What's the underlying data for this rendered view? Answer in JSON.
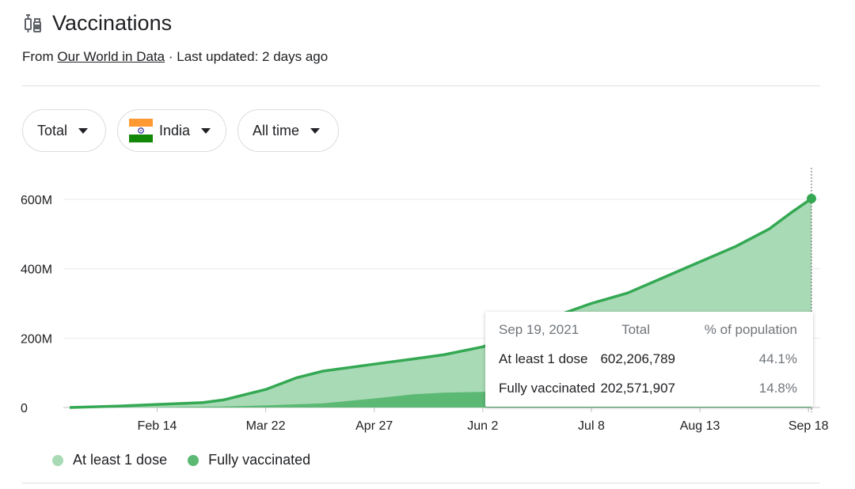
{
  "header": {
    "title": "Vaccinations",
    "source_prefix": "From",
    "source_link": "Our World in Data",
    "updated": "· Last updated: 2 days ago"
  },
  "filters": {
    "metric": "Total",
    "country": "India",
    "range": "All time"
  },
  "tooltip": {
    "date": "Sep 19, 2021",
    "col_total": "Total",
    "col_pct": "% of population",
    "rows": [
      {
        "label": "At least 1 dose",
        "total": "602,206,789",
        "pct": "44.1%"
      },
      {
        "label": "Fully vaccinated",
        "total": "202,571,907",
        "pct": "14.8%"
      }
    ]
  },
  "legend": {
    "first": "At least 1 dose",
    "second": "Fully vaccinated"
  },
  "colors": {
    "first_fill": "#a8dab5",
    "first_line": "#34a853",
    "second_fill": "#5bb974",
    "grid": "#e8eaed",
    "text_muted": "#70757a"
  },
  "icons": {
    "title": "syringe-icon",
    "flag": "india-flag-icon",
    "caret": "caret-down-icon"
  },
  "chart_data": {
    "type": "area",
    "title": "",
    "xlabel": "",
    "ylabel": "",
    "ylim": [
      0,
      600000000
    ],
    "yticks": [
      0,
      200000000,
      400000000,
      600000000
    ],
    "ytick_labels": [
      "0",
      "200M",
      "400M",
      "600M"
    ],
    "xtick_labels": [
      "Feb 14",
      "Mar 22",
      "Apr 27",
      "Jun 2",
      "Jul 8",
      "Aug 13",
      "Sep 18"
    ],
    "xtick_dates": [
      "2021-02-14",
      "2021-03-22",
      "2021-04-27",
      "2021-06-02",
      "2021-07-08",
      "2021-08-13",
      "2021-09-18"
    ],
    "xlim": [
      "2021-01-16",
      "2021-09-19"
    ],
    "series": [
      {
        "name": "At least 1 dose",
        "x": [
          "2021-01-16",
          "2021-02-01",
          "2021-02-14",
          "2021-03-01",
          "2021-03-08",
          "2021-03-22",
          "2021-04-01",
          "2021-04-10",
          "2021-04-27",
          "2021-05-10",
          "2021-05-20",
          "2021-06-02",
          "2021-06-15",
          "2021-06-25",
          "2021-07-08",
          "2021-07-20",
          "2021-08-01",
          "2021-08-13",
          "2021-08-25",
          "2021-09-05",
          "2021-09-12",
          "2021-09-19"
        ],
        "values": [
          0,
          4000000,
          9000000,
          14000000,
          22000000,
          52000000,
          85000000,
          105000000,
          125000000,
          140000000,
          152000000,
          175000000,
          215000000,
          260000000,
          300000000,
          330000000,
          375000000,
          420000000,
          465000000,
          515000000,
          560000000,
          602206789
        ]
      },
      {
        "name": "Fully vaccinated",
        "x": [
          "2021-01-16",
          "2021-02-14",
          "2021-03-08",
          "2021-03-22",
          "2021-04-10",
          "2021-04-27",
          "2021-05-10",
          "2021-05-20",
          "2021-06-02",
          "2021-06-25",
          "2021-07-08",
          "2021-08-13",
          "2021-09-19"
        ],
        "values": [
          0,
          1000000,
          3000000,
          6000000,
          12000000,
          26000000,
          38000000,
          43000000,
          45000000,
          55000000,
          70000000,
          130000000,
          202571907
        ]
      }
    ]
  }
}
